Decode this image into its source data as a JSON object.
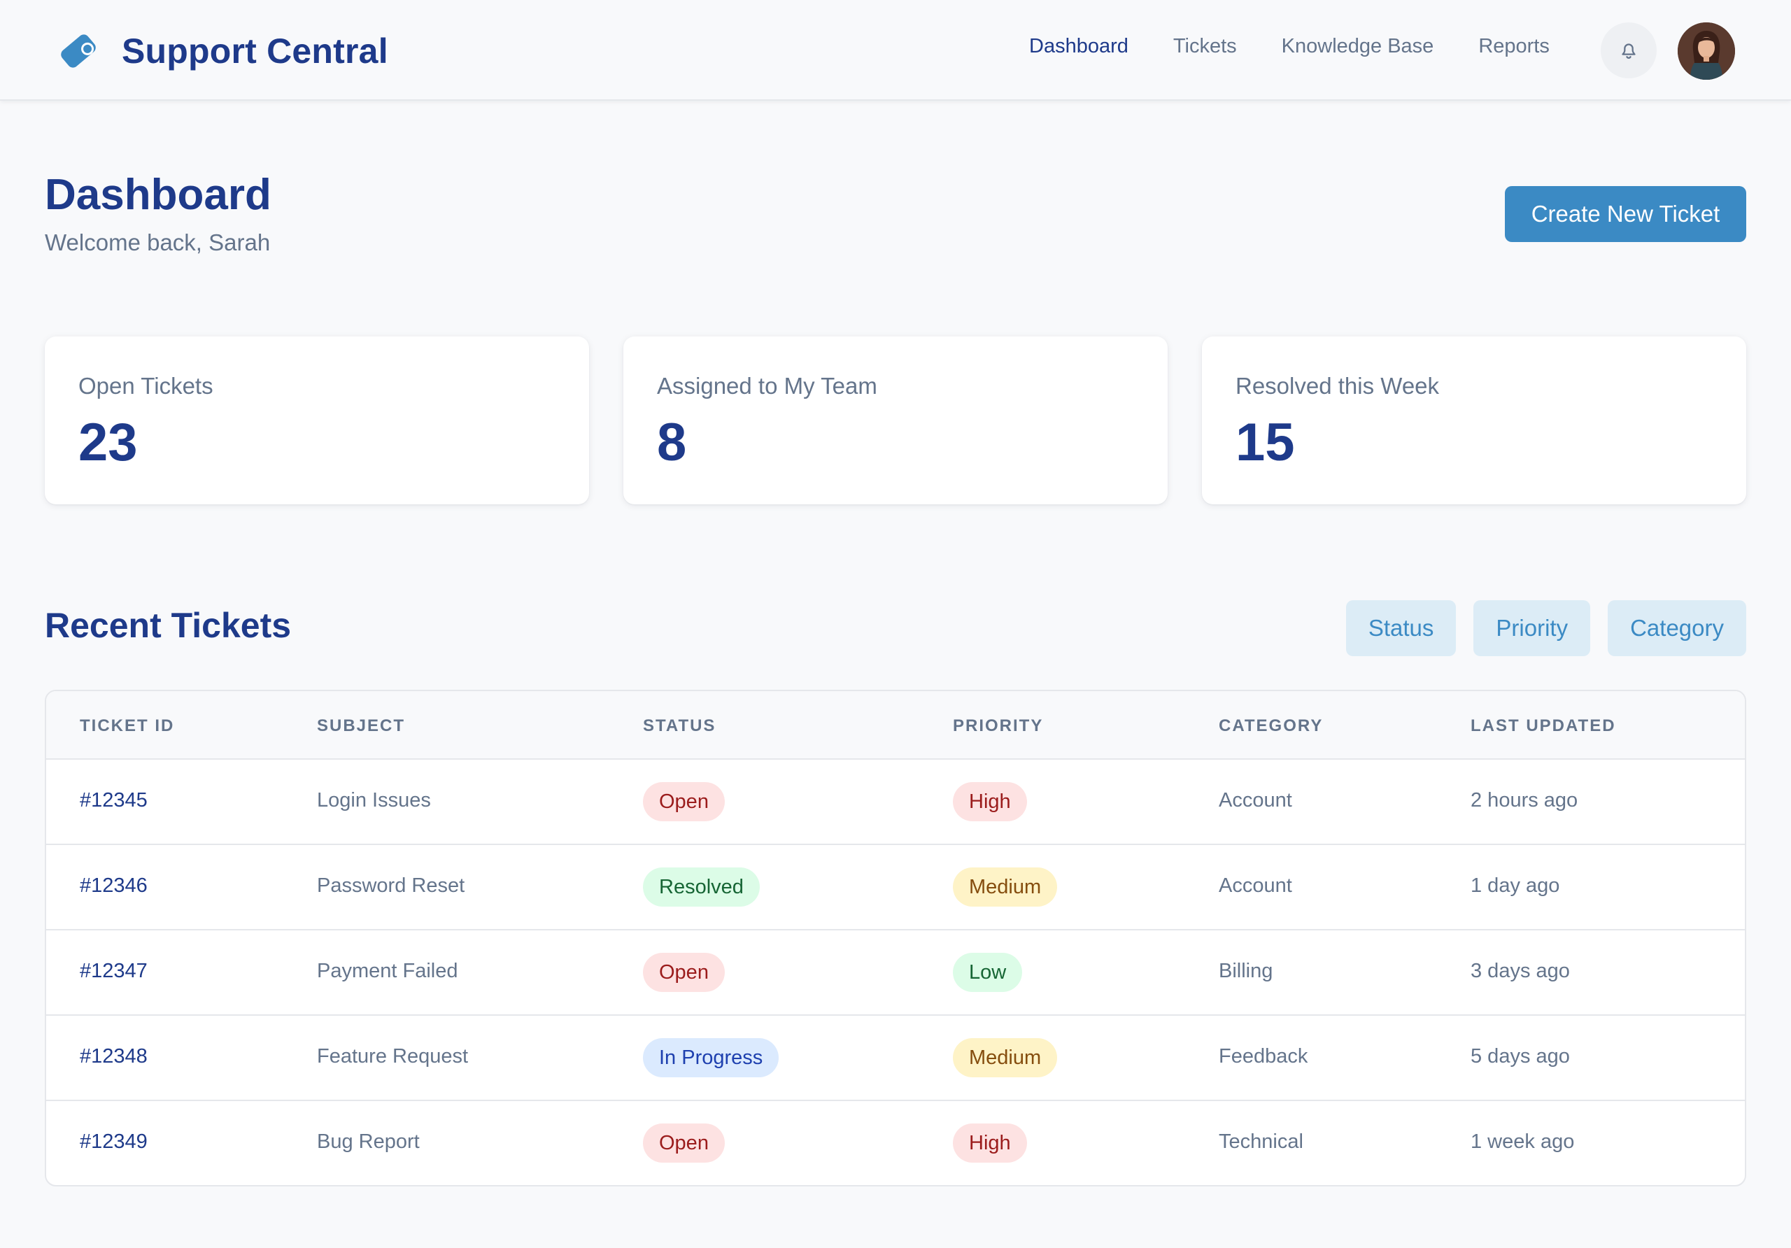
{
  "app": {
    "name": "Support Central",
    "logo_icon": "ticket-tag-icon",
    "accent_color": "#3b8ac4",
    "brand_color": "#1e3a8a"
  },
  "nav": {
    "items": [
      {
        "label": "Dashboard",
        "active": true
      },
      {
        "label": "Tickets",
        "active": false
      },
      {
        "label": "Knowledge Base",
        "active": false
      },
      {
        "label": "Reports",
        "active": false
      }
    ],
    "notifications_icon": "bell-icon",
    "avatar_icon": "user-avatar"
  },
  "page": {
    "title": "Dashboard",
    "subtitle": "Welcome back, Sarah",
    "primary_action": "Create New Ticket"
  },
  "stats": [
    {
      "label": "Open Tickets",
      "value": "23"
    },
    {
      "label": "Assigned to My Team",
      "value": "8"
    },
    {
      "label": "Resolved this Week",
      "value": "15"
    }
  ],
  "recent": {
    "title": "Recent Tickets",
    "filters": [
      "Status",
      "Priority",
      "Category"
    ],
    "columns": [
      "TICKET ID",
      "SUBJECT",
      "STATUS",
      "PRIORITY",
      "CATEGORY",
      "LAST UPDATED"
    ],
    "rows": [
      {
        "id": "#12345",
        "subject": "Login Issues",
        "status": "Open",
        "status_type": "open",
        "priority": "High",
        "priority_type": "high",
        "category": "Account",
        "updated": "2 hours ago"
      },
      {
        "id": "#12346",
        "subject": "Password Reset",
        "status": "Resolved",
        "status_type": "resolved",
        "priority": "Medium",
        "priority_type": "medium",
        "category": "Account",
        "updated": "1 day ago"
      },
      {
        "id": "#12347",
        "subject": "Payment Failed",
        "status": "Open",
        "status_type": "open",
        "priority": "Low",
        "priority_type": "low",
        "category": "Billing",
        "updated": "3 days ago"
      },
      {
        "id": "#12348",
        "subject": "Feature Request",
        "status": "In Progress",
        "status_type": "progress",
        "priority": "Medium",
        "priority_type": "medium",
        "category": "Feedback",
        "updated": "5 days ago"
      },
      {
        "id": "#12349",
        "subject": "Bug Report",
        "status": "Open",
        "status_type": "open",
        "priority": "High",
        "priority_type": "high",
        "category": "Technical",
        "updated": "1 week ago"
      }
    ]
  }
}
